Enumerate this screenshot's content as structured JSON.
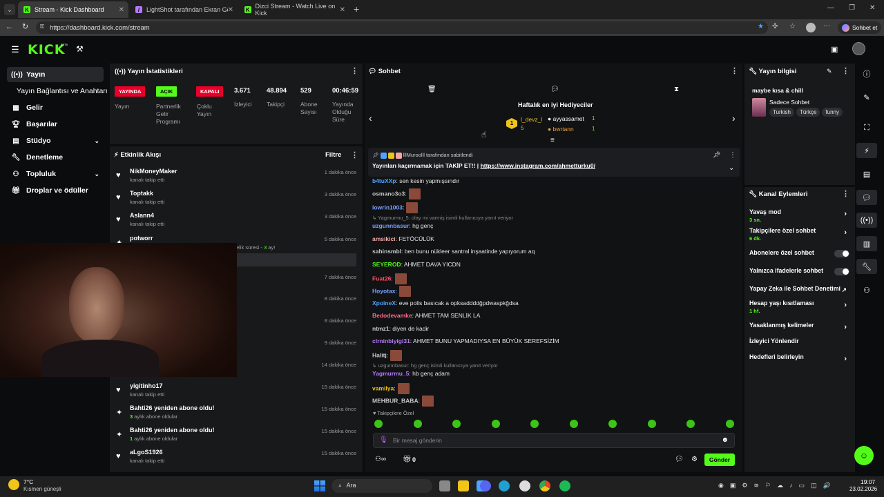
{
  "browser": {
    "tabs": [
      {
        "label": "Stream - Kick Dashboard",
        "active": true
      },
      {
        "label": "LightShot tarafından Ekran Görünt",
        "active": false
      },
      {
        "label": "Dizci Stream - Watch Live on Kick",
        "active": false
      }
    ],
    "url": "https://dashboard.kick.com/stream",
    "profile_label": "Sohbet et"
  },
  "header": {
    "logo": "KICK",
    "beta": "BETA"
  },
  "sidebar": {
    "items": [
      {
        "label": "Yayın",
        "icon": "broadcast-icon",
        "selected": true
      },
      {
        "label": "Yayın Bağlantısı ve Anahtarı",
        "icon": "",
        "selected": false
      },
      {
        "label": "Gelir",
        "icon": "revenue-icon",
        "selected": false
      },
      {
        "label": "Başarılar",
        "icon": "trophy-icon",
        "selected": false
      },
      {
        "label": "Stüdyo",
        "icon": "studio-icon",
        "selected": false,
        "expandable": true
      },
      {
        "label": "Denetleme",
        "icon": "wrench-icon",
        "selected": false
      },
      {
        "label": "Topluluk",
        "icon": "community-icon",
        "selected": false,
        "expandable": true
      },
      {
        "label": "Droplar ve ödüller",
        "icon": "gift-icon",
        "selected": false
      }
    ]
  },
  "stats": {
    "title": "Yayın İstatistikleri",
    "badges": [
      {
        "badge": "YAYINDA",
        "label": "Yayın",
        "color": "#e8002a"
      },
      {
        "badge": "AÇIK",
        "label": "Partnerlik Gelir Programı",
        "color": "#53fc18"
      },
      {
        "badge": "KAPALI",
        "label": "Çoklu Yayın",
        "color": "#e8002a"
      }
    ],
    "numbers": [
      {
        "value": "3.671",
        "label": "İzleyici"
      },
      {
        "value": "48.894",
        "label": "Takipçi"
      },
      {
        "value": "529",
        "label": "Abone Sayısı"
      },
      {
        "value": "00:46:59",
        "label": "Yayında Olduğu Süre"
      }
    ]
  },
  "activity": {
    "title": "Etkinlik Akışı",
    "filter_label": "Filtre",
    "items": [
      {
        "name": "NikMoneyMaker",
        "sub": "kanalı takip etti",
        "time": "1 dakika önce",
        "icon": "heart"
      },
      {
        "name": "Toptakk",
        "sub": "kanalı takip etti",
        "time": "3 dakika önce",
        "icon": "heart"
      },
      {
        "name": "Aslann4",
        "sub": "kanalı takip etti",
        "time": "3 dakika önce",
        "icon": "heart"
      },
      {
        "name": "potworr",
        "sub": "",
        "time": "5 dakika önce",
        "icon": "sparkle"
      },
      {
        "name": "",
        "sub": "",
        "time": "7 dakika önce",
        "icon": ""
      },
      {
        "name": "",
        "sub": "",
        "time": "8 dakika önce",
        "icon": ""
      },
      {
        "name": "",
        "sub": "",
        "time": "8 dakika önce",
        "icon": ""
      },
      {
        "name": "",
        "sub": "",
        "time": "9 dakika önce",
        "icon": ""
      },
      {
        "name": "",
        "sub": "",
        "time": "14 dakika önce",
        "icon": ""
      },
      {
        "name": "yigitinho17",
        "sub": "kanalı takip etti",
        "time": "15 dakika önce",
        "icon": "heart"
      },
      {
        "name": "Bahti26 yeniden abone oldu!",
        "sub_num": "3",
        "sub": "aylık abone oldular",
        "time": "15 dakika önce",
        "icon": "sparkle"
      },
      {
        "name": "Bahti26 yeniden abone oldu!",
        "sub_num": "1",
        "sub": "aylık abone oldular",
        "time": "15 dakika önce",
        "icon": "sparkle"
      },
      {
        "name": "aLgoS1926",
        "sub": "kanalı takip etti",
        "time": "15 dakika önce",
        "icon": "heart"
      }
    ],
    "partial_text": "elik süresi - ",
    "partial_num": "3",
    "partial_suffix": " ay!"
  },
  "chat": {
    "title": "Sohbet",
    "gifters_title": "Haftalık en iyi Hediyeciler",
    "gifters": [
      {
        "rank": "1",
        "name": "l_devz_l",
        "count": "5"
      },
      {
        "name": "ayyassamet",
        "count": "1"
      },
      {
        "name": "bwrtann",
        "count": "1"
      }
    ],
    "pinned_by": "lllMuroolll tarafından sabitlendi",
    "pinned_text": "Yayınları kaçırmamak için TAKİP ET!! |",
    "pinned_link": "https://www.instagram.com/ahmetturku0/",
    "messages": [
      {
        "user": "b4tuXXp",
        "color": "#4fa3ff",
        "text": ": sen kesin yapmışsındır"
      },
      {
        "user": "osmano3o3",
        "color": "#c8c8c8",
        "text": ":",
        "emote": true
      },
      {
        "user": "lowrin1003",
        "color": "#7aa0ff",
        "text": ":",
        "emote": true
      },
      {
        "reply": "Yagmurmu_5: olay mi varmiş isimli kullanıcıya yanıt veriyor"
      },
      {
        "user": "uzgunnbasur",
        "color": "#7aa0ff",
        "text": ": hg genç"
      },
      {
        "user": "amsikici",
        "color": "#f4a7a7",
        "text": ": FETÖCÜLÜK"
      },
      {
        "user": "sahinsmbl",
        "color": "#c8c8c8",
        "text": ": ben bunu nükleer santral inşaatinde yapıyorum aq"
      },
      {
        "user": "SEYEROD",
        "color": "#53fc18",
        "text": ": AHMET DAVA YICDN"
      },
      {
        "user": "Fuat26",
        "color": "#ff4f6a",
        "text": ":",
        "emote": true
      },
      {
        "user": "Hoyotax",
        "color": "#7aa0ff",
        "text": ":",
        "emote": true
      },
      {
        "user": "XpoineX",
        "color": "#4fa3ff",
        "text": ": eve polis basıcak a opksaddddğpdwaspkğdsa"
      },
      {
        "user": "Bedodevamke",
        "color": "#ff6a8a",
        "text": ": AHMET TAM SENLİK LA"
      },
      {
        "user": "ntmz1",
        "color": "#c8c8c8",
        "text": ": diyen de kadir"
      },
      {
        "user": "clrninbiyigi31",
        "color": "#b67aff",
        "text": ": AHMET BUNU YAPMADIYSA EN BÜYÜK SEREFSİZİM"
      },
      {
        "user": "Halitj",
        "color": "#c8c8c8",
        "text": ":",
        "emote": true
      },
      {
        "reply": "uzgunnbasur: hg genç isimli kullanıcıya yanıt veriyor"
      },
      {
        "user": "Yagmurmu_5",
        "color": "#b67aff",
        "text": ": hb genç adam"
      },
      {
        "user": "vamilya",
        "color": "#f0c419",
        "text": ":",
        "emote": true
      },
      {
        "user": "MEHBUR_BABA",
        "color": "#c8c8c8",
        "text": ":",
        "emote": true
      }
    ],
    "followers_only": "Takipçilere Özel",
    "input_placeholder": "Bir mesaj gönderin",
    "count": "0",
    "send_label": "Gönder"
  },
  "info": {
    "title": "Yayın bilgisi",
    "stream_title": "maybe kısa & chill",
    "category": "Sadece Sohbet",
    "tags": [
      "Turkish",
      "Türkçe",
      "funny"
    ]
  },
  "channel_actions": {
    "title": "Kanal Eylemleri",
    "rows": [
      {
        "label": "Yavaş mod",
        "sub": "3 sn.",
        "kind": "chevron"
      },
      {
        "label": "Takipçilere özel sohbet",
        "sub": "6 dk.",
        "kind": "chevron"
      },
      {
        "label": "Abonelere özel sohbet",
        "sub": "",
        "kind": "toggle"
      },
      {
        "label": "Yalnızca ifadelerle sohbet",
        "sub": "",
        "kind": "toggle"
      },
      {
        "label": "Yapay Zeka ile Sohbet Denetimi",
        "sub": "",
        "kind": "external"
      },
      {
        "label": "Hesap yaşı kısıtlaması",
        "sub": "1 hf.",
        "kind": "chevron"
      },
      {
        "label": "Yasaklanmış kelimeler",
        "sub": "",
        "kind": "chevron"
      },
      {
        "label": "İzleyici Yönlendir",
        "sub": "",
        "kind": "none"
      },
      {
        "label": "Hedefleri belirleyin",
        "sub": "",
        "kind": "chevron"
      }
    ]
  },
  "taskbar": {
    "weather_temp": "7°C",
    "weather_desc": "Kısmen güneşli",
    "search_label": "Ara",
    "time": "19:07",
    "date": "23.02.2026"
  }
}
